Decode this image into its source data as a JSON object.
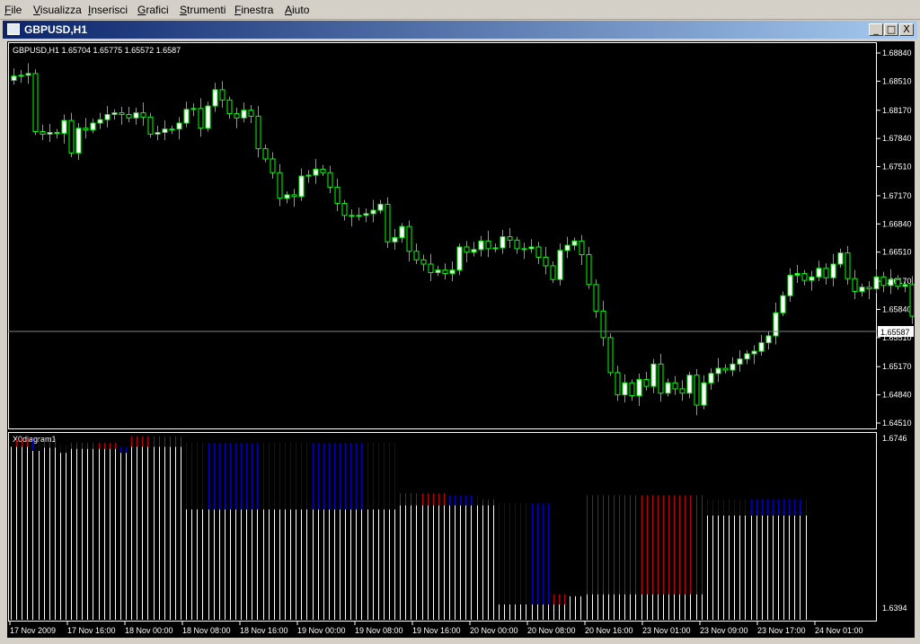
{
  "menu": [
    {
      "label": "File",
      "u": "F",
      "rest": "ile"
    },
    {
      "label": "Visualizza",
      "u": "V",
      "rest": "isualizza"
    },
    {
      "label": "Inserisci",
      "u": "I",
      "rest": "nserisci"
    },
    {
      "label": "Grafici",
      "u": "G",
      "rest": "rafici"
    },
    {
      "label": "Strumenti",
      "u": "S",
      "rest": "trumenti"
    },
    {
      "label": "Finestra",
      "u": "F",
      "rest": "inestra"
    },
    {
      "label": "Aiuto",
      "u": "A",
      "rest": "iuto"
    }
  ],
  "window": {
    "title": "GBPUSD,H1",
    "minimize": "_",
    "maximize": "□",
    "close": "X"
  },
  "colors": {
    "bull": "#ffffff",
    "bear": "#000000",
    "wick": "#00ff00",
    "axis": "#ffffff",
    "indicator_red": "#c00000",
    "indicator_blue": "#0000c0",
    "indicator_white": "#ffffff",
    "bid_line": "#808080"
  },
  "chart_data": [
    {
      "type": "candlestick",
      "info": "GBPUSD,H1  1.65704 1.65775 1.65572 1.6587",
      "price_labels": [
        "1.68840",
        "1.68510",
        "1.68170",
        "1.67840",
        "1.67510",
        "1.67170",
        "1.66840",
        "1.66510",
        "1.66170",
        "1.65840",
        "1.65510",
        "1.65170",
        "1.64840",
        "1.64510"
      ],
      "current_price": "1.65587",
      "ylim": [
        1.6451,
        1.6884
      ],
      "time_labels": [
        "17 Nov 2009",
        "17 Nov 16:00",
        "18 Nov 00:00",
        "18 Nov 08:00",
        "18 Nov 16:00",
        "19 Nov 00:00",
        "19 Nov 08:00",
        "19 Nov 16:00",
        "20 Nov 00:00",
        "20 Nov 08:00",
        "20 Nov 16:00",
        "23 Nov 01:00",
        "23 Nov 09:00",
        "23 Nov 17:00",
        "24 Nov 01:00"
      ],
      "closes": [
        1.6857,
        1.6858,
        1.686,
        1.6792,
        1.6789,
        1.6791,
        1.679,
        1.6805,
        1.6767,
        1.6796,
        1.6794,
        1.6802,
        1.6806,
        1.6812,
        1.6814,
        1.6812,
        1.6808,
        1.6814,
        1.6809,
        1.6789,
        1.6791,
        1.6795,
        1.6795,
        1.6802,
        1.6818,
        1.6819,
        1.6796,
        1.6822,
        1.6841,
        1.6829,
        1.6813,
        1.6808,
        1.6817,
        1.681,
        1.6772,
        1.676,
        1.6744,
        1.6714,
        1.6718,
        1.6716,
        1.674,
        1.6741,
        1.6748,
        1.6744,
        1.6727,
        1.6708,
        1.6694,
        1.6693,
        1.6694,
        1.6696,
        1.67,
        1.6707,
        1.6663,
        1.6668,
        1.6681,
        1.6652,
        1.6642,
        1.6637,
        1.6627,
        1.663,
        1.6626,
        1.663,
        1.6657,
        1.6651,
        1.6654,
        1.6664,
        1.6655,
        1.6656,
        1.6669,
        1.6665,
        1.6655,
        1.6655,
        1.6657,
        1.6645,
        1.6635,
        1.6619,
        1.6653,
        1.6659,
        1.6664,
        1.6648,
        1.6613,
        1.6582,
        1.6551,
        1.651,
        1.6484,
        1.6498,
        1.6483,
        1.6502,
        1.6494,
        1.652,
        1.6486,
        1.6498,
        1.6491,
        1.6486,
        1.6507,
        1.6472,
        1.6498,
        1.6509,
        1.6515,
        1.6513,
        1.652,
        1.6526,
        1.6532,
        1.6535,
        1.6545,
        1.6553,
        1.658,
        1.66,
        1.6624,
        1.6626,
        1.6618,
        1.6622,
        1.6632,
        1.6621,
        1.6637,
        1.665,
        1.662,
        1.6605,
        1.661,
        1.6608,
        1.6622,
        1.6612,
        1.6619,
        1.6611,
        1.6613,
        1.6576,
        1.657,
        1.6569,
        1.657,
        1.6565,
        1.6572,
        1.6583,
        1.6573,
        1.6559
      ]
    },
    {
      "type": "bar",
      "title": "X0diagram1",
      "price_labels": [
        "1.6746",
        "1.6394"
      ],
      "ylim": [
        1.6394,
        1.6746
      ],
      "segments": [
        {
          "color": "white",
          "count": 1,
          "base": 1.6394,
          "top": 1.6724
        },
        {
          "color": "red",
          "count": 3,
          "base": 1.6724,
          "top": 1.674
        },
        {
          "color": "blue",
          "count": 2,
          "base": 1.6716,
          "top": 1.674
        },
        {
          "color": "red",
          "count": 3,
          "base": 1.6722,
          "top": 1.674
        },
        {
          "color": "blue",
          "count": 2,
          "base": 1.6712,
          "top": 1.6728
        },
        {
          "color": "red",
          "count": 9,
          "base": 1.672,
          "top": 1.6732
        },
        {
          "color": "blue",
          "count": 2,
          "base": 1.6712,
          "top": 1.6724
        },
        {
          "color": "red",
          "count": 10,
          "base": 1.6724,
          "top": 1.6744
        },
        {
          "color": "blue",
          "count": 39,
          "base": 1.66,
          "top": 1.6732
        },
        {
          "color": "red",
          "count": 9,
          "base": 1.6608,
          "top": 1.6632
        },
        {
          "color": "blue",
          "count": 6,
          "base": 1.6608,
          "top": 1.6628
        },
        {
          "color": "red",
          "count": 3,
          "base": 1.6608,
          "top": 1.662
        },
        {
          "color": "blue",
          "count": 10,
          "base": 1.6412,
          "top": 1.6612
        },
        {
          "color": "red",
          "count": 3,
          "base": 1.6412,
          "top": 1.6432
        },
        {
          "color": "white",
          "count": 3,
          "base": 1.6394,
          "top": 1.6428
        },
        {
          "color": "red",
          "count": 22,
          "base": 1.6432,
          "top": 1.6628
        },
        {
          "color": "blue",
          "count": 19,
          "base": 1.6588,
          "top": 1.662
        }
      ]
    }
  ]
}
